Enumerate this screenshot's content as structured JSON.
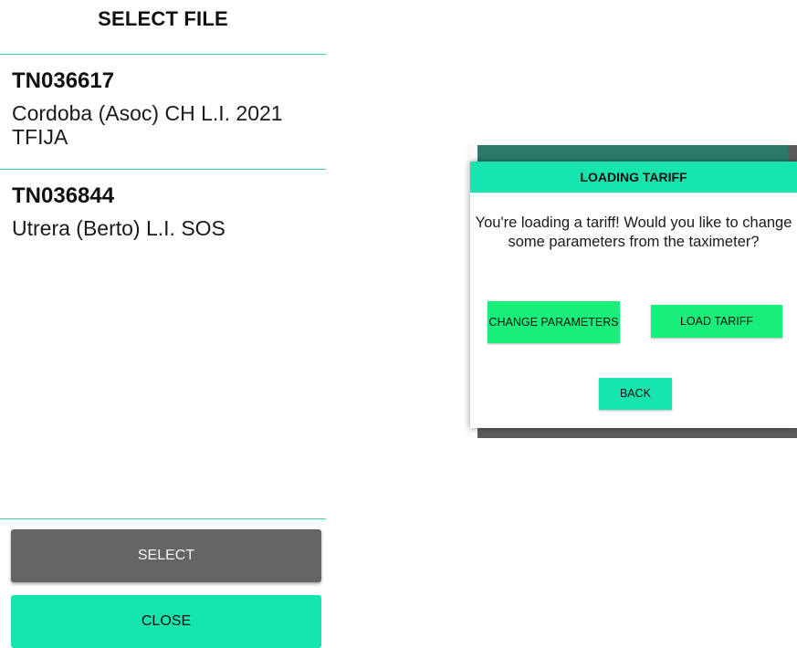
{
  "select_file": {
    "title": "SELECT FILE",
    "files": [
      {
        "code": "TN036617",
        "name": "Cordoba (Asoc) CH L.I. 2021 TFIJA"
      },
      {
        "code": "TN036844",
        "name": "Utrera (Berto) L.I. SOS"
      }
    ],
    "select_label": "SELECT",
    "close_label": "CLOSE"
  },
  "dialog": {
    "title": "LOADING TARIFF",
    "message": "You're loading a tariff! Would you like to change some parameters from the taximeter?",
    "change_parameters_label": "CHANGE PARAMETERS",
    "load_tariff_label": "LOAD TARIFF",
    "back_label": "BACK"
  },
  "colors": {
    "accent": "#17e5ae",
    "button_green": "#17ef7a",
    "select_gray": "#656565",
    "divider": "#3ad3a7"
  }
}
